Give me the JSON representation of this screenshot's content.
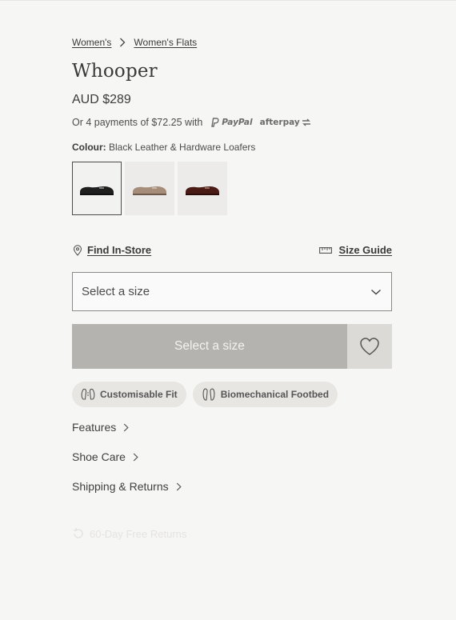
{
  "breadcrumb": {
    "items": [
      "Women's",
      "Women's Flats"
    ]
  },
  "product": {
    "name": "Whooper",
    "price": "AUD $289",
    "payments_text": "Or 4 payments of $72.25 with",
    "paypal_label": "PayPal",
    "afterpay_label": "afterpay",
    "colour_label": "Colour:",
    "colour_value": "Black Leather & Hardware Loafers"
  },
  "swatches": [
    {
      "name": "black",
      "color": "#1f1f1f",
      "selected": true
    },
    {
      "name": "taupe",
      "color": "#a58d7a",
      "selected": false
    },
    {
      "name": "burgundy",
      "color": "#4a1a14",
      "selected": false
    }
  ],
  "links": {
    "find_in_store": "Find In-Store",
    "size_guide": "Size Guide"
  },
  "size_select": {
    "value": "Select a size"
  },
  "cta": {
    "label": "Select a size"
  },
  "chips": [
    "Customisable Fit",
    "Biomechanical Footbed"
  ],
  "accordions": [
    "Features",
    "Shoe Care",
    "Shipping & Returns"
  ],
  "faded_note": "60-Day Free Returns"
}
